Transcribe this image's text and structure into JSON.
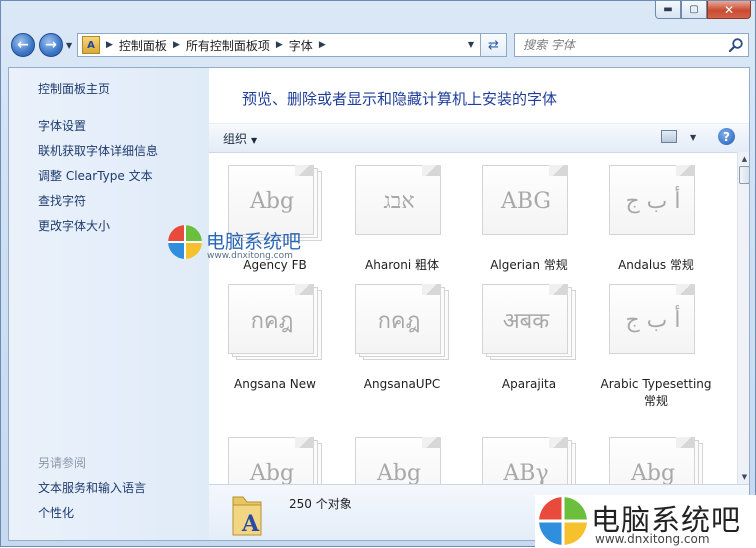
{
  "window": {
    "minimize_glyph": "▬",
    "maximize_glyph": "▢",
    "close_glyph": "✕"
  },
  "address": {
    "crumbs": [
      "控制面板",
      "所有控制面板项",
      "字体"
    ],
    "search_placeholder": "搜索 字体"
  },
  "sidebar": {
    "home": "控制面板主页",
    "tasks": [
      "字体设置",
      "联机获取字体详细信息",
      "调整 ClearType 文本",
      "查找字符",
      "更改字体大小"
    ],
    "see_also_heading": "另请参阅",
    "see_also": [
      "文本服务和输入语言",
      "个性化"
    ]
  },
  "main": {
    "title": "预览、删除或者显示和隐藏计算机上安装的字体",
    "organize_label": "组织"
  },
  "fonts": [
    {
      "name": "Agency FB",
      "sample": "Abg",
      "stacked": true
    },
    {
      "name": "Aharoni 粗体",
      "sample": "אבג",
      "stacked": false
    },
    {
      "name": "Algerian 常规",
      "sample": "ABG",
      "stacked": false
    },
    {
      "name": "Andalus 常规",
      "sample": "أ ب ج",
      "stacked": false
    },
    {
      "name": "Angsana New",
      "sample": "กคฎ",
      "stacked": true
    },
    {
      "name": "AngsanaUPC",
      "sample": "กคฎ",
      "stacked": true
    },
    {
      "name": "Aparajita",
      "sample": "अबक",
      "stacked": true
    },
    {
      "name": "Arabic Typesetting 常规",
      "sample": "أ ب ج",
      "stacked": false
    },
    {
      "name": "",
      "sample": "Abg",
      "stacked": true
    },
    {
      "name": "",
      "sample": "Abg",
      "stacked": false
    },
    {
      "name": "",
      "sample": "ABγ",
      "stacked": true
    },
    {
      "name": "",
      "sample": "Abg",
      "stacked": true
    }
  ],
  "details": {
    "count_text": "250 个对象"
  },
  "watermark": {
    "small_text": "电脑系统吧",
    "small_url": "www.dnxitong.com",
    "big_text": "电脑系统吧",
    "big_url": "www.dnxitong.com"
  },
  "colors": {
    "title_blue": "#1f3e9a",
    "link_blue": "#1e3b6d",
    "sidebar_bg": "#e4edf9"
  },
  "icons": [
    "back-arrow-icon",
    "forward-arrow-icon",
    "fonts-folder-icon",
    "refresh-icon",
    "search-icon",
    "view-icon",
    "help-icon"
  ]
}
